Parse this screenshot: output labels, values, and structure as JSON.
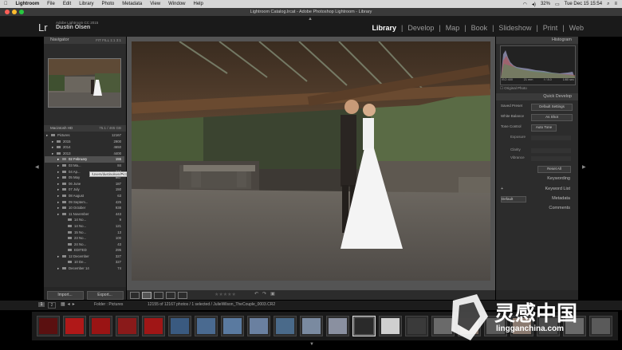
{
  "menubar": {
    "app_name": "Lightroom",
    "items": [
      "File",
      "Edit",
      "Library",
      "Photo",
      "Metadata",
      "View",
      "Window",
      "Help"
    ],
    "battery": "32%",
    "clock": "Tue Dec 15  15:54"
  },
  "window": {
    "title": "Lightroom Catalog.lrcat - Adobe Photoshop Lightroom - Library"
  },
  "identity": {
    "logo": "Lr",
    "product": "Adobe Lightroom CC 2015",
    "user": "Dustin Olsen"
  },
  "modules": [
    "Library",
    "Develop",
    "Map",
    "Book",
    "Slideshow",
    "Print",
    "Web"
  ],
  "active_module": "Library",
  "left_panel": {
    "navigator_title": "Navigator",
    "navigator_zoom": [
      "FIT",
      "FILL",
      "1:1",
      "3:1"
    ],
    "volume": {
      "name": "Macintosh HD",
      "info": "75.1 / 465 GB"
    },
    "folders": [
      {
        "name": "Pictures",
        "count": "12167",
        "level": 0
      },
      {
        "name": "2015",
        "count": "2900",
        "level": 1
      },
      {
        "name": "2014",
        "count": "4650",
        "level": 1
      },
      {
        "name": "2013",
        "count": "4400",
        "level": 1
      },
      {
        "name": "02 February",
        "count": "155",
        "level": 2,
        "selected": true
      },
      {
        "name": "03 Ma...",
        "count": "84",
        "level": 2
      },
      {
        "name": "04 Ap...",
        "count": "213",
        "level": 2
      },
      {
        "name": "05 May",
        "count": "667",
        "level": 2
      },
      {
        "name": "06 June",
        "count": "187",
        "level": 2
      },
      {
        "name": "07 July",
        "count": "150",
        "level": 2
      },
      {
        "name": "08 August",
        "count": "63",
        "level": 2
      },
      {
        "name": "09 Septem...",
        "count": "425",
        "level": 2
      },
      {
        "name": "10 October",
        "count": "938",
        "level": 2
      },
      {
        "name": "11 November",
        "count": "443",
        "level": 2
      },
      {
        "name": "14 No...",
        "count": "9",
        "level": 3
      },
      {
        "name": "14 No...",
        "count": "121",
        "level": 3
      },
      {
        "name": "15 No...",
        "count": "13",
        "level": 3
      },
      {
        "name": "23 No...",
        "count": "100",
        "level": 3
      },
      {
        "name": "24 No...",
        "count": "43",
        "level": 3
      },
      {
        "name": "EDITED",
        "count": "295",
        "level": 3
      },
      {
        "name": "12 December",
        "count": "327",
        "level": 2
      },
      {
        "name": "10 De...",
        "count": "327",
        "level": 3
      },
      {
        "name": "December 14",
        "count": "74",
        "level": 2
      }
    ],
    "tooltip": "/Users/dustinolsen/Pictures/2013/02 February",
    "import_label": "Import...",
    "export_label": "Export..."
  },
  "right_panel": {
    "histogram_title": "Histogram",
    "exif": [
      "ISO 400",
      "21 mm",
      "f / 8.0",
      "1/80 sec"
    ],
    "original_photo": "Original Photo",
    "quick_develop_title": "Quick Develop",
    "saved_preset_label": "Saved Preset",
    "saved_preset_value": "Default Settings",
    "white_balance_label": "White Balance",
    "white_balance_value": "As Shot",
    "tone_control_label": "Tone Control",
    "auto_tone": "Auto Tone",
    "sliders": [
      "Exposure",
      "Clarity",
      "Vibrance"
    ],
    "reset_all": "Reset All",
    "keywording": "Keywording",
    "keyword_list": "Keyword List",
    "metadata": "Metadata",
    "metadata_preset": "Default",
    "comments": "Comments"
  },
  "filmbar": {
    "pages": [
      "1",
      "2"
    ],
    "path": "Folder : Pictures",
    "info": "12155 of 12167 photos / 1 selected / JulieWilson_TheCouple_0003.CR2"
  },
  "watermark": {
    "brand": "灵感中国",
    "url": "lingganchina.com"
  },
  "colors": {
    "accent": "#ffffff",
    "panel": "#2c2c2c",
    "selected": "#505050"
  }
}
